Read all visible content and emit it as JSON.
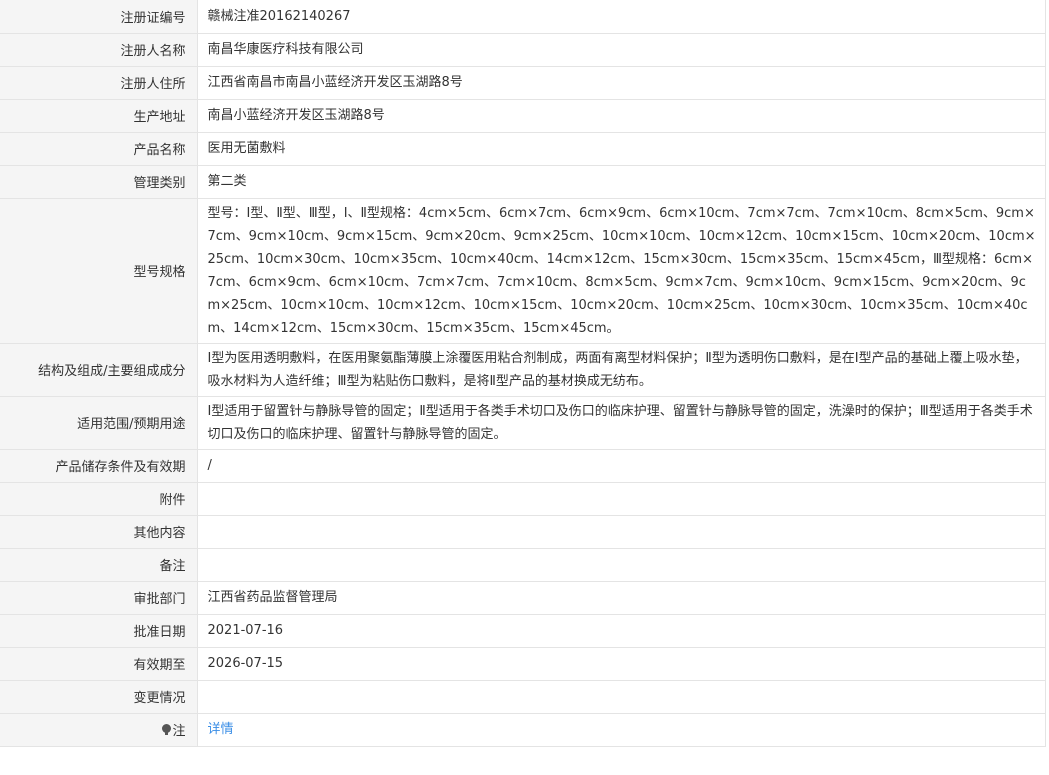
{
  "rows": [
    {
      "label": "注册证编号",
      "value": "赣械注准20162140267"
    },
    {
      "label": "注册人名称",
      "value": "南昌华康医疗科技有限公司"
    },
    {
      "label": "注册人住所",
      "value": "江西省南昌市南昌小蓝经济开发区玉湖路8号"
    },
    {
      "label": "生产地址",
      "value": "南昌小蓝经济开发区玉湖路8号"
    },
    {
      "label": "产品名称",
      "value": "医用无菌敷料"
    },
    {
      "label": "管理类别",
      "value": "第二类"
    },
    {
      "label": "型号规格",
      "value": "型号：Ⅰ型、Ⅱ型、Ⅲ型，Ⅰ、Ⅱ型规格：4cm×5cm、6cm×7cm、6cm×9cm、6cm×10cm、7cm×7cm、7cm×10cm、8cm×5cm、9cm×7cm、9cm×10cm、9cm×15cm、9cm×20cm、9cm×25cm、10cm×10cm、10cm×12cm、10cm×15cm、10cm×20cm、10cm×25cm、10cm×30cm、10cm×35cm、10cm×40cm、14cm×12cm、15cm×30cm、15cm×35cm、15cm×45cm，Ⅲ型规格：6cm×7cm、6cm×9cm、6cm×10cm、7cm×7cm、7cm×10cm、8cm×5cm、9cm×7cm、9cm×10cm、9cm×15cm、9cm×20cm、9cm×25cm、10cm×10cm、10cm×12cm、10cm×15cm、10cm×20cm、10cm×25cm、10cm×30cm、10cm×35cm、10cm×40cm、14cm×12cm、15cm×30cm、15cm×35cm、15cm×45cm。"
    },
    {
      "label": "结构及组成/主要组成成分",
      "value": "Ⅰ型为医用透明敷料，在医用聚氨酯薄膜上涂覆医用粘合剂制成，两面有离型材料保护；Ⅱ型为透明伤口敷料，是在Ⅰ型产品的基础上覆上吸水垫，吸水材料为人造纤维；Ⅲ型为粘贴伤口敷料，是将Ⅱ型产品的基材换成无纺布。"
    },
    {
      "label": "适用范围/预期用途",
      "value": "Ⅰ型适用于留置针与静脉导管的固定；Ⅱ型适用于各类手术切口及伤口的临床护理、留置针与静脉导管的固定，洗澡时的保护；Ⅲ型适用于各类手术切口及伤口的临床护理、留置针与静脉导管的固定。"
    },
    {
      "label": "产品储存条件及有效期",
      "value": "/"
    },
    {
      "label": "附件",
      "value": ""
    },
    {
      "label": "其他内容",
      "value": ""
    },
    {
      "label": "备注",
      "value": ""
    },
    {
      "label": "审批部门",
      "value": "江西省药品监督管理局"
    },
    {
      "label": "批准日期",
      "value": "2021-07-16"
    },
    {
      "label": "有效期至",
      "value": "2026-07-15"
    },
    {
      "label": "变更情况",
      "value": ""
    }
  ],
  "note": {
    "icon": "lightbulb-icon",
    "label": "注",
    "link_text": "详情",
    "link_color": "#3a8ee6"
  },
  "colors": {
    "label_background": "#f5f5f5",
    "border": "#e4e4e4",
    "text": "#333333"
  }
}
